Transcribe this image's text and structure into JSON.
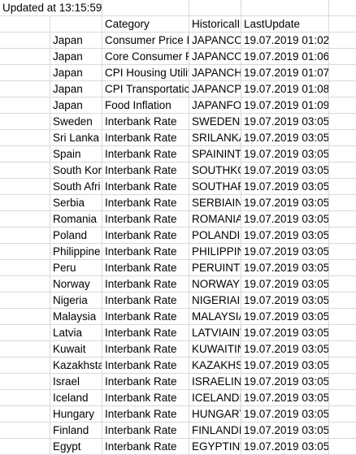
{
  "updated_text": "Updated at 13:15:59",
  "headers": [
    "",
    "Category",
    "HistoricalI",
    "LastUpdate"
  ],
  "rows": [
    [
      "Japan",
      "Consumer Price I",
      "JAPANCOI",
      "19.07.2019 01:02"
    ],
    [
      "Japan",
      "Core Consumer P",
      "JAPANCOI",
      "19.07.2019 01:06"
    ],
    [
      "Japan",
      "CPI Housing Utilit",
      "JAPANCHU",
      "19.07.2019 01:07"
    ],
    [
      "Japan",
      "CPI Transportatic",
      "JAPANCPI",
      "19.07.2019 01:08"
    ],
    [
      "Japan",
      "Food Inflation",
      "JAPANFOO",
      "19.07.2019 01:09"
    ],
    [
      "Sweden",
      "Interbank Rate",
      "SWEDENIN",
      "19.07.2019 03:05"
    ],
    [
      "Sri Lanka",
      "Interbank Rate",
      "SRILANKA",
      "19.07.2019 03:05"
    ],
    [
      "Spain",
      "Interbank Rate",
      "SPAININTI",
      "19.07.2019 03:05"
    ],
    [
      "South Kor",
      "Interbank Rate",
      "SOUTHKO",
      "19.07.2019 03:05"
    ],
    [
      "South Afri",
      "Interbank Rate",
      "SOUTHAFI",
      "19.07.2019 03:05"
    ],
    [
      "Serbia",
      "Interbank Rate",
      "SERBIAINT",
      "19.07.2019 03:05"
    ],
    [
      "Romania",
      "Interbank Rate",
      "ROMANIA",
      "19.07.2019 03:05"
    ],
    [
      "Poland",
      "Interbank Rate",
      "POLANDIN",
      "19.07.2019 03:05"
    ],
    [
      "Philippine",
      "Interbank Rate",
      "PHILIPPIN",
      "19.07.2019 03:05"
    ],
    [
      "Peru",
      "Interbank Rate",
      "PERUINTR",
      "19.07.2019 03:05"
    ],
    [
      "Norway",
      "Interbank Rate",
      "NORWAYI",
      "19.07.2019 03:05"
    ],
    [
      "Nigeria",
      "Interbank Rate",
      "NIGERIAIN",
      "19.07.2019 03:05"
    ],
    [
      "Malaysia",
      "Interbank Rate",
      "MALAYSIA",
      "19.07.2019 03:05"
    ],
    [
      "Latvia",
      "Interbank Rate",
      "LATVIAINT",
      "19.07.2019 03:05"
    ],
    [
      "Kuwait",
      "Interbank Rate",
      "KUWAITIN",
      "19.07.2019 03:05"
    ],
    [
      "Kazakhsta",
      "Interbank Rate",
      "KAZAKHST",
      "19.07.2019 03:05"
    ],
    [
      "Israel",
      "Interbank Rate",
      "ISRAELINT",
      "19.07.2019 03:05"
    ],
    [
      "Iceland",
      "Interbank Rate",
      "ICELANDIN",
      "19.07.2019 03:05"
    ],
    [
      "Hungary",
      "Interbank Rate",
      "HUNGARY",
      "19.07.2019 03:05"
    ],
    [
      "Finland",
      "Interbank Rate",
      "FINLANDI",
      "19.07.2019 03:05"
    ],
    [
      "Egypt",
      "Interbank Rate",
      "EGYPTINTI",
      "19.07.2019 03:05"
    ]
  ]
}
